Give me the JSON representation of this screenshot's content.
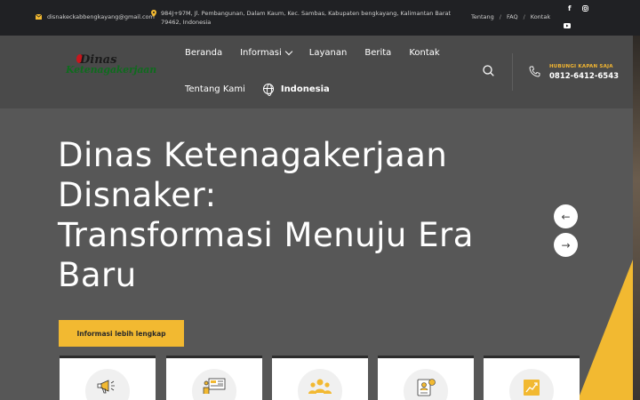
{
  "topbar": {
    "email": "disnakeckabbengkayang@gmail.com",
    "address": "984J+97M, Jl. Pembangunan, Dalam Kaum, Kec. Sambas, Kabupaten bengkayang, Kalimantan Barat 79462, Indonesia",
    "links": [
      "Tentang",
      "FAQ",
      "Kontak"
    ],
    "separator": "/",
    "social": [
      "facebook-icon",
      "instagram-icon",
      "youtube-icon"
    ]
  },
  "header": {
    "logo_line1": "Dinas",
    "logo_line2": "Ketenagakerjaan",
    "nav_row1": [
      "Beranda",
      "Informasi",
      "Layanan",
      "Berita",
      "Kontak"
    ],
    "nav_row2": [
      "Tentang Kami"
    ],
    "language": "Indonesia",
    "hotline_label": "HUBUNGI KAPAN SAJA",
    "hotline_number": "0812-6412-6543"
  },
  "hero": {
    "title_lines": [
      "Dinas Ketenagakerjaan",
      "Disnaker:",
      "Transformasi Menuju Era",
      "Baru"
    ],
    "cta_label": "Informasi lebih lengkap",
    "prev_arrow": "←",
    "next_arrow": "→"
  },
  "cards": [
    "megaphone-icon",
    "presentation-icon",
    "group-icon",
    "job-profile-icon",
    "growth-chart-icon"
  ],
  "colors": {
    "accent": "#f2b931",
    "topbar": "#202124",
    "header": "#4a4a4a",
    "hero": "#575757"
  }
}
